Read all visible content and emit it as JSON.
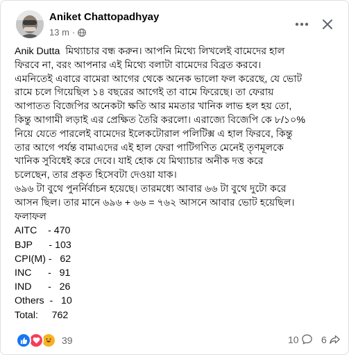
{
  "post": {
    "author": "Aniket Chattopadhyay",
    "time": "13 m",
    "mention": "Anik Dutta",
    "lines": [
      "মিথ্যাচার বন্ধ করুন। আপনি মিথ্যে লিখলেই বামেদের হাল",
      "ফিরবে না, বরং আপনার এই মিথ্যে বলাটা বামেদের বিব্রত করবে।",
      "এমনিতেই এবারে বামেরা আগের থেকে অনেক ভালো ফল করেছে, যে ভোট",
      "রামে চলে গিয়েছিল ১৪ বছরের আগেই তা বামে ফিরেছে। তা ফেরায়",
      "আপাতত বিজেপির অনেকটা ক্ষতি আর মমতার খানিক লাভ হল হয় তো,",
      "কিন্তু আগামী লড়াই এর প্রেক্ষিত তৈরি করলো। এরাজ্যে বিজেপি কে ৮/১০%",
      "নিয়ে যেতে পারলেই বামেদের ইলেকটোরাল পলিটিক্স এ হাল ফিরবে, কিন্তু",
      "তার আগে পর্যন্ত বামাএদের এই হাল ফেরা পাটিগণিত মেনেই তৃণমূলকে",
      "খানিক সুবিধেই করে দেবে। যাই হোক যে মিথ্যাচার অনীক দত্ত করে",
      "চলেছেন, তার প্রকৃত হিসেবটা দেওয়া যাক।",
      "৬৯৬ টা বুথে পুনর্নির্বাচন হয়েছে। তারমধ্যে আবার ৬৬ টা বুথে দুটো করে",
      "আসন ছিল। তার মানে ৬৯৬ + ৬৬ = ৭৬২ আসনে আবার ভোট হয়েছিল।",
      "ফলাফল"
    ],
    "results": [
      "AITC    - 470",
      "BJP      - 103",
      "CPI(M) -   62",
      "INC      -   91",
      "IND      -   26",
      "Others  -   10",
      "Total:     762"
    ]
  },
  "footer": {
    "reaction_count": "39",
    "comment_count": "10",
    "share_count": "6"
  },
  "icons": {
    "privacy": "globe-icon",
    "more": "more-options-icon",
    "close": "close-icon",
    "comment": "comment-icon",
    "share": "share-icon"
  },
  "colors": {
    "like": "#1877f2",
    "love": "#f33e58",
    "haha": "#f7b125",
    "secondary_text": "#65676b"
  }
}
